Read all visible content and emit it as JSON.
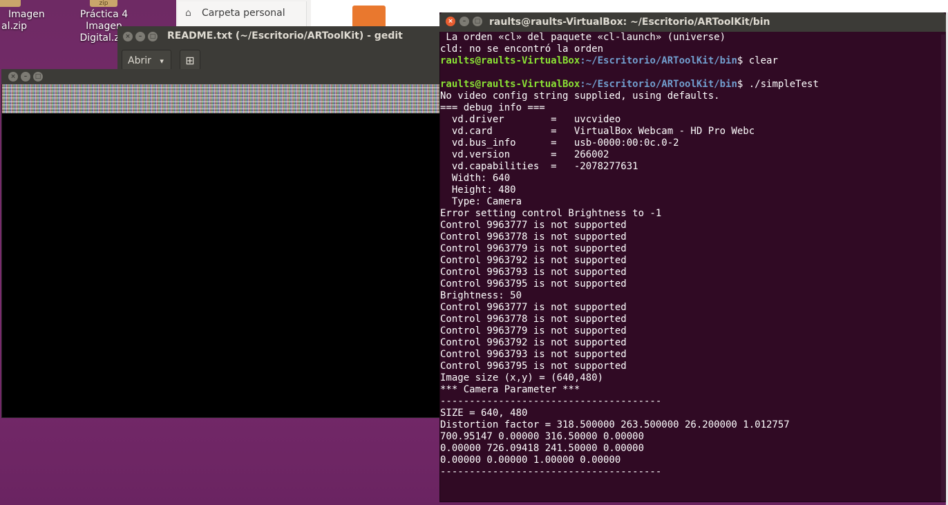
{
  "desktop": {
    "icon1_label_line1": "Imagen",
    "icon1_label_line2": "al.zip",
    "icon2_label_line1": "Práctica 4 Imagen",
    "icon2_label_line2": "Digital.zip",
    "icon2_badge": "zip"
  },
  "file_manager": {
    "sidebar_item": "Carpeta personal"
  },
  "gedit": {
    "title": "README.txt (~/Escritorio/ARToolKit) - gedit",
    "open_button": "Abrir",
    "open_caret": "▾",
    "new_button": "⊞"
  },
  "video_window": {
    "title": ""
  },
  "terminal": {
    "title": "raults@raults-VirtualBox: ~/Escritorio/ARToolKit/bin",
    "prompt_user": "raults@raults-VirtualBox",
    "prompt_path": ":~/Escritorio/ARToolKit/bin",
    "lines": [
      {
        "text": " La orden «cl» del paquete «cl-launch» (universe)"
      },
      {
        "text": "cld: no se encontró la orden"
      },
      {
        "prompt": true,
        "cmd": "$ clear"
      },
      {
        "text": ""
      },
      {
        "prompt": true,
        "cmd": "$ ./simpleTest"
      },
      {
        "text": "No video config string supplied, using defaults."
      },
      {
        "text": "=== debug info ==="
      },
      {
        "text": "  vd.driver        =   uvcvideo"
      },
      {
        "text": "  vd.card          =   VirtualBox Webcam - HD Pro Webc"
      },
      {
        "text": "  vd.bus_info      =   usb-0000:00:0c.0-2"
      },
      {
        "text": "  vd.version       =   266002"
      },
      {
        "text": "  vd.capabilities  =   -2078277631"
      },
      {
        "text": "  Width: 640"
      },
      {
        "text": "  Height: 480"
      },
      {
        "text": "  Type: Camera"
      },
      {
        "text": "Error setting control Brightness to -1"
      },
      {
        "text": "Control 9963777 is not supported"
      },
      {
        "text": "Control 9963778 is not supported"
      },
      {
        "text": "Control 9963779 is not supported"
      },
      {
        "text": "Control 9963792 is not supported"
      },
      {
        "text": "Control 9963793 is not supported"
      },
      {
        "text": "Control 9963795 is not supported"
      },
      {
        "text": "Brightness: 50"
      },
      {
        "text": "Control 9963777 is not supported"
      },
      {
        "text": "Control 9963778 is not supported"
      },
      {
        "text": "Control 9963779 is not supported"
      },
      {
        "text": "Control 9963792 is not supported"
      },
      {
        "text": "Control 9963793 is not supported"
      },
      {
        "text": "Control 9963795 is not supported"
      },
      {
        "text": "Image size (x,y) = (640,480)"
      },
      {
        "text": "*** Camera Parameter ***"
      },
      {
        "text": "--------------------------------------"
      },
      {
        "text": "SIZE = 640, 480"
      },
      {
        "text": "Distortion factor = 318.500000 263.500000 26.200000 1.012757"
      },
      {
        "text": "700.95147 0.00000 316.50000 0.00000"
      },
      {
        "text": "0.00000 726.09418 241.50000 0.00000"
      },
      {
        "text": "0.00000 0.00000 1.00000 0.00000"
      },
      {
        "text": "--------------------------------------"
      }
    ]
  },
  "colors": {
    "terminal_bg": "#300a24",
    "prompt_user": "#8ae234",
    "prompt_path": "#729fcf",
    "titlebar": "#3c3b37",
    "close_button": "#e85d30"
  },
  "icons": {
    "close": "close-icon",
    "minimize": "minimize-icon",
    "maximize": "maximize-icon",
    "home": "home-icon"
  }
}
